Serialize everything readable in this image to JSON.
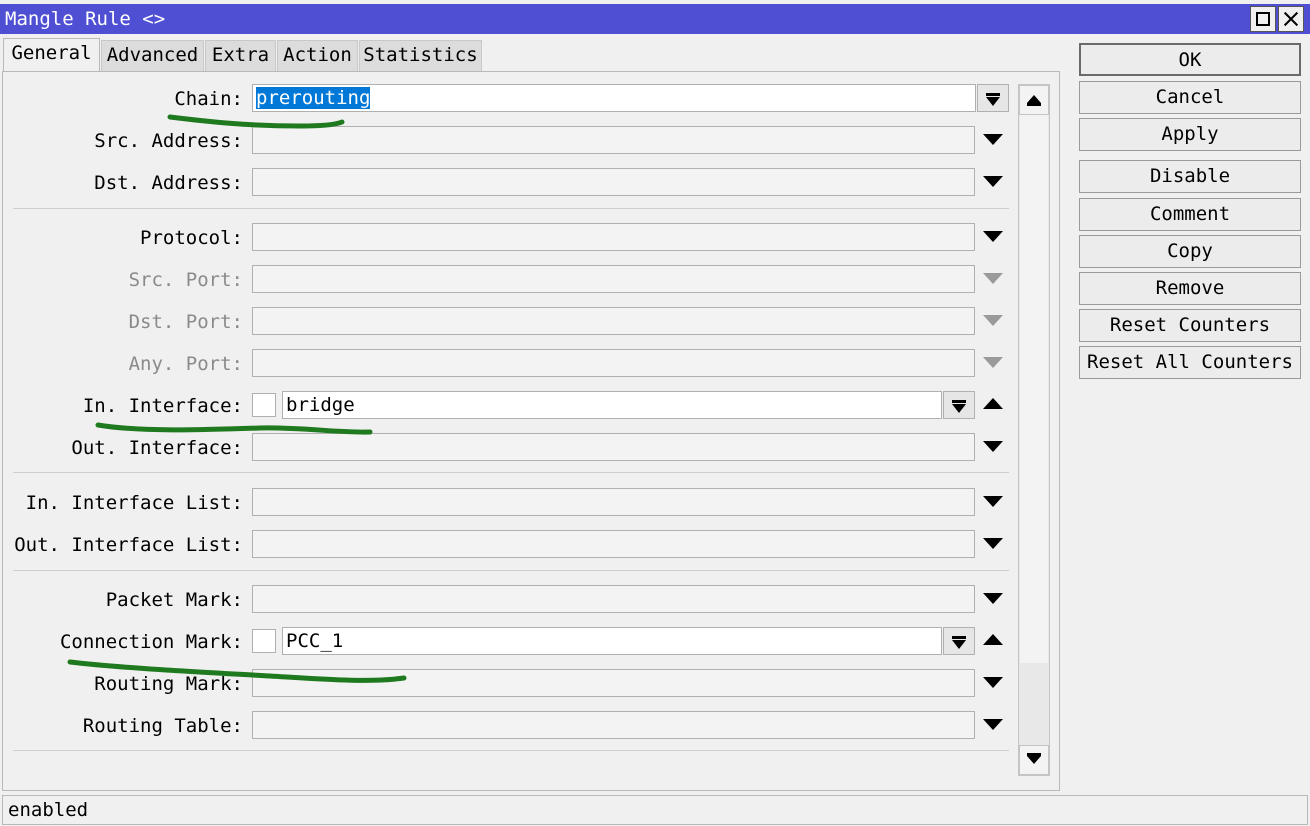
{
  "window": {
    "title": "Mangle Rule <>"
  },
  "tabs": [
    {
      "label": "General"
    },
    {
      "label": "Advanced"
    },
    {
      "label": "Extra"
    },
    {
      "label": "Action"
    },
    {
      "label": "Statistics"
    }
  ],
  "fields": {
    "chain": {
      "label": "Chain:",
      "value": "prerouting"
    },
    "src_address": {
      "label": "Src. Address:",
      "value": ""
    },
    "dst_address": {
      "label": "Dst. Address:",
      "value": ""
    },
    "protocol": {
      "label": "Protocol:",
      "value": ""
    },
    "src_port": {
      "label": "Src. Port:",
      "value": ""
    },
    "dst_port": {
      "label": "Dst. Port:",
      "value": ""
    },
    "any_port": {
      "label": "Any. Port:",
      "value": ""
    },
    "in_interface": {
      "label": "In. Interface:",
      "value": "bridge"
    },
    "out_interface": {
      "label": "Out. Interface:",
      "value": ""
    },
    "in_interface_list": {
      "label": "In. Interface List:",
      "value": ""
    },
    "out_interface_list": {
      "label": "Out. Interface List:",
      "value": ""
    },
    "packet_mark": {
      "label": "Packet Mark:",
      "value": ""
    },
    "connection_mark": {
      "label": "Connection Mark:",
      "value": "PCC_1"
    },
    "routing_mark": {
      "label": "Routing Mark:",
      "value": ""
    },
    "routing_table": {
      "label": "Routing Table:",
      "value": ""
    }
  },
  "buttons": {
    "ok": "OK",
    "cancel": "Cancel",
    "apply": "Apply",
    "disable": "Disable",
    "comment": "Comment",
    "copy": "Copy",
    "remove": "Remove",
    "reset_counters": "Reset Counters",
    "reset_all_counters": "Reset All Counters"
  },
  "status": {
    "text": "enabled"
  },
  "colors": {
    "titlebar": "#4f4fd4",
    "selection": "#0078d7",
    "annotation": "#1f7a1f"
  }
}
